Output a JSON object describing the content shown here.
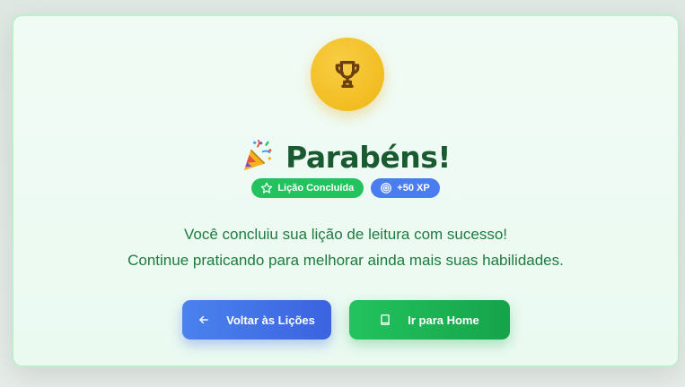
{
  "card": {
    "icon": "trophy-icon",
    "title": "Parabéns!",
    "title_emoji": "party-popper-icon",
    "badges": [
      {
        "label": "Lição Concluída",
        "icon": "star-icon",
        "color": "#22c35e"
      },
      {
        "label": "+50 XP",
        "icon": "target-icon",
        "color": "#4a7df0"
      }
    ],
    "message_lines": [
      "Você concluiu sua lição de leitura com sucesso!",
      "Continue praticando para melhorar ainda mais suas habilidades."
    ],
    "buttons": {
      "back": {
        "label": "Voltar às Lições",
        "icon": "arrow-left-icon",
        "color": "#3b63e0"
      },
      "home": {
        "label": "Ir para Home",
        "icon": "book-icon",
        "color": "#16a34a"
      }
    }
  },
  "colors": {
    "title": "#1a5a30",
    "message": "#1f7a3f",
    "trophy": "#f2bd22",
    "card_border": "#bfeccd"
  }
}
